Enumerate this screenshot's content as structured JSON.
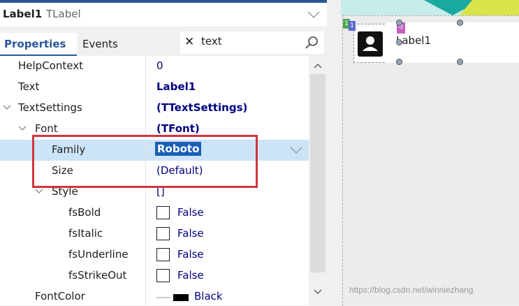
{
  "object_selector": {
    "name": "Label1",
    "type": "TLabel"
  },
  "tabs": [
    {
      "label": "Properties"
    },
    {
      "label": "Events"
    }
  ],
  "search": {
    "value": "text"
  },
  "properties": [
    {
      "name": "HelpContext",
      "value": "0"
    },
    {
      "name": "Text",
      "value": "Label1"
    },
    {
      "name": "TextSettings",
      "value": "(TTextSettings)"
    },
    {
      "name": "Font",
      "value": "(TFont)"
    },
    {
      "name": "Family",
      "value": "Roboto"
    },
    {
      "name": "Size",
      "value": "(Default)"
    },
    {
      "name": "Style",
      "value": "[]"
    },
    {
      "name": "fsBold",
      "value": "False"
    },
    {
      "name": "fsItalic",
      "value": "False"
    },
    {
      "name": "fsUnderline",
      "value": "False"
    },
    {
      "name": "fsStrikeOut",
      "value": "False"
    },
    {
      "name": "FontColor",
      "value": "Black"
    }
  ],
  "designer": {
    "label_text": "Label1",
    "tag_1": "1",
    "tag_2": "1",
    "tag_3": "d"
  },
  "watermark": "https://blog.csdn.net/winniezhang",
  "colors": {
    "accent": "#2b579a",
    "selection": "#1a5fb4",
    "highlight_box": "#d1343c"
  }
}
